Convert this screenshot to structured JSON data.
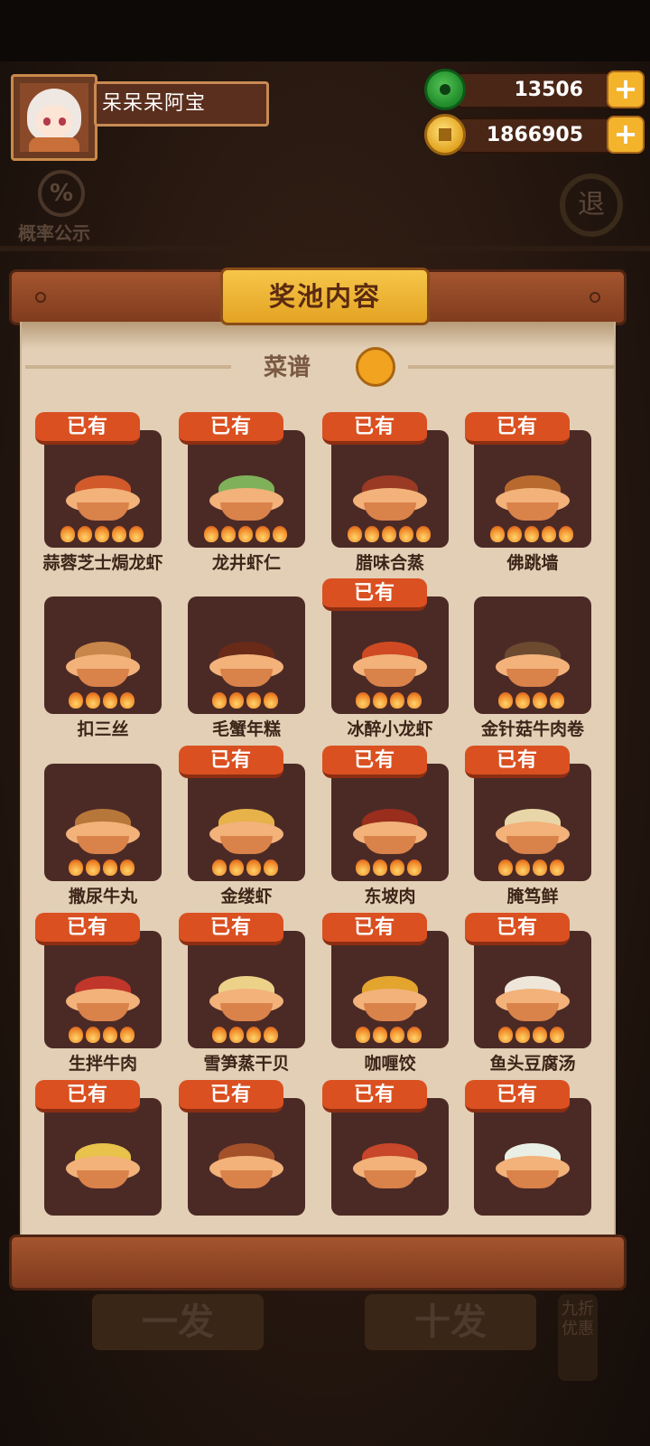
{
  "player": {
    "name": "呆呆呆阿宝"
  },
  "currency": {
    "jade": "13506",
    "gold": "1866905",
    "add_label": "+"
  },
  "side": {
    "probability_label": "概率公示",
    "probability_symbol": "%",
    "exit_label": "退"
  },
  "modal": {
    "title": "奖池内容",
    "section_title": "菜谱",
    "owned_label": "已有",
    "dishes": [
      {
        "name": "蒜蓉芝士焗龙虾",
        "owned": true,
        "stars": 5,
        "food_color": "#d25a2a"
      },
      {
        "name": "龙井虾仁",
        "owned": true,
        "stars": 5,
        "food_color": "#7fb15a"
      },
      {
        "name": "腊味合蒸",
        "owned": true,
        "stars": 5,
        "food_color": "#9a3a24"
      },
      {
        "name": "佛跳墙",
        "owned": true,
        "stars": 5,
        "food_color": "#b86a2e"
      },
      {
        "name": "扣三丝",
        "owned": false,
        "stars": 4,
        "food_color": "#c9864a"
      },
      {
        "name": "毛蟹年糕",
        "owned": false,
        "stars": 4,
        "food_color": "#6a2a18"
      },
      {
        "name": "冰醉小龙虾",
        "owned": true,
        "stars": 4,
        "food_color": "#cf4a22"
      },
      {
        "name": "金针菇牛肉卷",
        "owned": false,
        "stars": 4,
        "food_color": "#6b4a30"
      },
      {
        "name": "撒尿牛丸",
        "owned": false,
        "stars": 4,
        "food_color": "#b8773a"
      },
      {
        "name": "金缕虾",
        "owned": true,
        "stars": 4,
        "food_color": "#e7b24a"
      },
      {
        "name": "东坡肉",
        "owned": true,
        "stars": 4,
        "food_color": "#9a2e1c"
      },
      {
        "name": "腌笃鲜",
        "owned": true,
        "stars": 4,
        "food_color": "#e8d6a8"
      },
      {
        "name": "生拌牛肉",
        "owned": true,
        "stars": 4,
        "food_color": "#c0362a"
      },
      {
        "name": "雪笋蒸干贝",
        "owned": true,
        "stars": 4,
        "food_color": "#ecd288"
      },
      {
        "name": "咖喱饺",
        "owned": true,
        "stars": 4,
        "food_color": "#e3a52e"
      },
      {
        "name": "鱼头豆腐汤",
        "owned": true,
        "stars": 4,
        "food_color": "#efe6da"
      },
      {
        "name": "",
        "owned": true,
        "stars": 0,
        "food_color": "#e8c24a"
      },
      {
        "name": "",
        "owned": true,
        "stars": 0,
        "food_color": "#a4512a"
      },
      {
        "name": "",
        "owned": true,
        "stars": 0,
        "food_color": "#c8462a"
      },
      {
        "name": "",
        "owned": true,
        "stars": 0,
        "food_color": "#e9efe4"
      }
    ]
  },
  "background_buttons": {
    "single": "一发",
    "ten": "十发",
    "discount": "九折优惠"
  }
}
